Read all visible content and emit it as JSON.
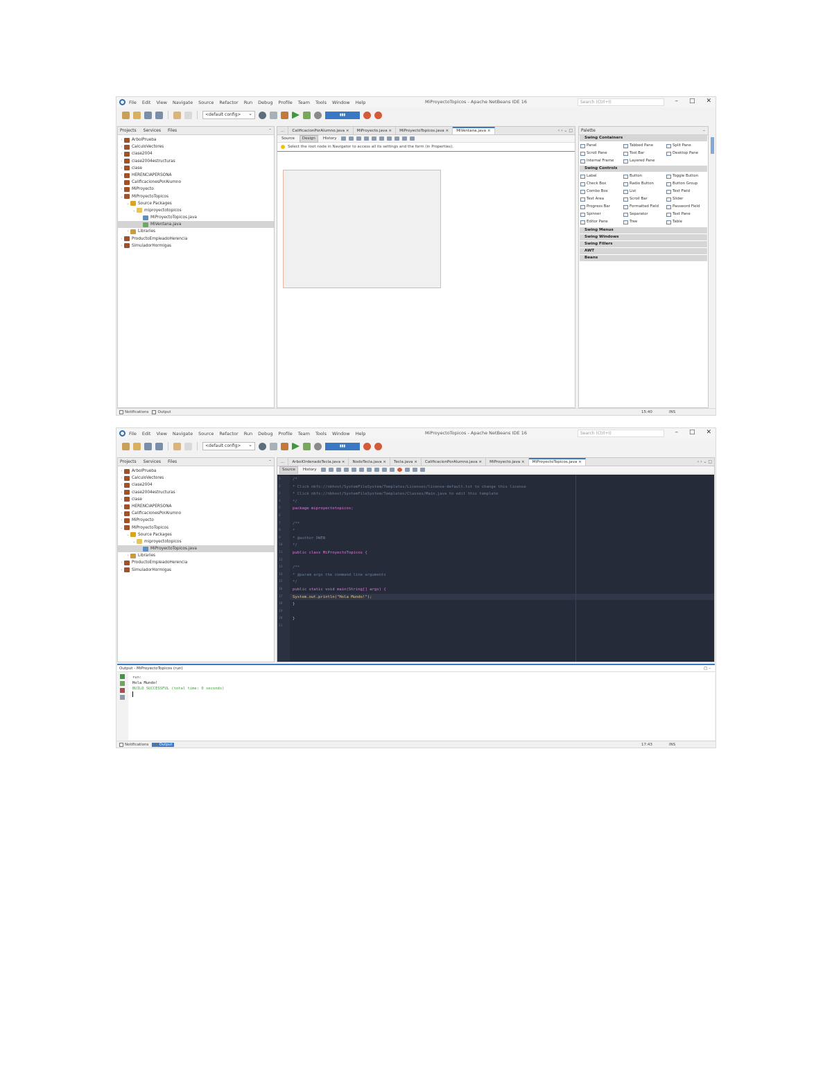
{
  "ide1": {
    "menu": [
      "File",
      "Edit",
      "View",
      "Navigate",
      "Source",
      "Refactor",
      "Run",
      "Debug",
      "Profile",
      "Team",
      "Tools",
      "Window",
      "Help"
    ],
    "window_title": "MiProyectoTopicos - Apache NetBeans IDE 16",
    "search_placeholder": "Search (Ctrl+I)",
    "config_select": "<default config>",
    "project_tabs": [
      "Projects",
      "Services",
      "Files"
    ],
    "tree": [
      {
        "label": "ArbolPrueba",
        "icon": "project-icon",
        "arrow": "›",
        "indent": 0
      },
      {
        "label": "CalculoVectores",
        "icon": "project-icon",
        "arrow": "›",
        "indent": 0
      },
      {
        "label": "clase2004",
        "icon": "project-icon",
        "arrow": "›",
        "indent": 0
      },
      {
        "label": "clase2004estructuras",
        "icon": "project-icon",
        "arrow": "›",
        "indent": 0
      },
      {
        "label": "clase",
        "icon": "project-icon",
        "arrow": "›",
        "indent": 0
      },
      {
        "label": "HERENCIAPERSONA",
        "icon": "project-icon",
        "arrow": "›",
        "indent": 0
      },
      {
        "label": "CalificacionesPorAlumno",
        "icon": "project-icon",
        "arrow": "",
        "indent": 0
      },
      {
        "label": "MiProyecto",
        "icon": "project-icon",
        "arrow": "›",
        "indent": 0
      },
      {
        "label": "MiProyectoTopicos",
        "icon": "project-icon",
        "arrow": "⌄",
        "indent": 0
      },
      {
        "label": "Source Packages",
        "icon": "package-folder-icon",
        "arrow": "⌄",
        "indent": 1
      },
      {
        "label": "miproyectotopicos",
        "icon": "package-icon",
        "arrow": "⌄",
        "indent": 2
      },
      {
        "label": "MiProyectoTopicos.java",
        "icon": "java-file-icon",
        "arrow": "",
        "indent": 3
      },
      {
        "label": "MiVentana.java",
        "icon": "form-file-icon",
        "arrow": "",
        "indent": 3,
        "selected": true
      },
      {
        "label": "Libraries",
        "icon": "library-icon",
        "arrow": "›",
        "indent": 1
      },
      {
        "label": "ProductoEmpleadoHerencia",
        "icon": "project-icon",
        "arrow": "›",
        "indent": 0
      },
      {
        "label": "SimuladorHormigas",
        "icon": "project-icon",
        "arrow": "›",
        "indent": 0
      }
    ],
    "editor_tabs": [
      "CalificacionPorAlumno.java",
      "MiProyecto.java",
      "MiProyectoTopicos.java",
      "MiVentana.java"
    ],
    "editor_tabs_lead": "...",
    "active_tab": "MiVentana.java",
    "view_buttons": [
      "Source",
      "Design",
      "History"
    ],
    "design_hint": "Select the root node in Navigator to access all its settings and the form (in Properties).",
    "palette_title": "Palette",
    "palette": {
      "swing_containers": {
        "title": "Swing Containers",
        "items": [
          "Panel",
          "Tabbed Pane",
          "Split Pane",
          "Scroll Pane",
          "Tool Bar",
          "Desktop Pane",
          "Internal Frame",
          "Layered Pane"
        ]
      },
      "swing_controls": {
        "title": "Swing Controls",
        "items": [
          "Label",
          "Button",
          "Toggle Button",
          "Check Box",
          "Radio Button",
          "Button Group",
          "Combo Box",
          "List",
          "Text Field",
          "Text Area",
          "Scroll Bar",
          "Slider",
          "Progress Bar",
          "Formatted Field",
          "Password Field",
          "Spinner",
          "Separator",
          "Text Pane",
          "Editor Pane",
          "Tree",
          "Table"
        ]
      },
      "collapsed": [
        "Swing Menus",
        "Swing Windows",
        "Swing Fillers",
        "AWT",
        "Beans"
      ]
    },
    "status": {
      "navigator": "Notifications",
      "output": "Output",
      "position": "15:40",
      "mode": "INS"
    }
  },
  "ide2": {
    "menu": [
      "File",
      "Edit",
      "View",
      "Navigate",
      "Source",
      "Refactor",
      "Run",
      "Debug",
      "Profile",
      "Team",
      "Tools",
      "Window",
      "Help"
    ],
    "window_title": "MiProyectoTopicos - Apache NetBeans IDE 16",
    "search_placeholder": "Search (Ctrl+I)",
    "config_select": "<default config>",
    "project_tabs": [
      "Projects",
      "Services",
      "Files"
    ],
    "tree": [
      {
        "label": "ArbolPrueba",
        "icon": "project-icon",
        "arrow": "›",
        "indent": 0
      },
      {
        "label": "CalculoVectores",
        "icon": "project-icon",
        "arrow": "›",
        "indent": 0
      },
      {
        "label": "clase2004",
        "icon": "project-icon",
        "arrow": "›",
        "indent": 0
      },
      {
        "label": "clase2004estructuras",
        "icon": "project-icon",
        "arrow": "›",
        "indent": 0
      },
      {
        "label": "clase",
        "icon": "project-icon",
        "arrow": "›",
        "indent": 0
      },
      {
        "label": "HERENCIAPERSONA",
        "icon": "project-icon",
        "arrow": "›",
        "indent": 0
      },
      {
        "label": "CalificacionesPorAlumno",
        "icon": "project-icon",
        "arrow": "›",
        "indent": 0
      },
      {
        "label": "MiProyecto",
        "icon": "project-icon",
        "arrow": "›",
        "indent": 0
      },
      {
        "label": "MiProyectoTopicos",
        "icon": "project-icon",
        "arrow": "⌄",
        "indent": 0
      },
      {
        "label": "Source Packages",
        "icon": "package-folder-icon",
        "arrow": "⌄",
        "indent": 1
      },
      {
        "label": "miproyectotopicos",
        "icon": "package-icon",
        "arrow": "⌄",
        "indent": 2
      },
      {
        "label": "MiProyectoTopicos.java",
        "icon": "java-file-icon",
        "arrow": "",
        "indent": 3,
        "selected": true
      },
      {
        "label": "Libraries",
        "icon": "library-icon",
        "arrow": "›",
        "indent": 1
      },
      {
        "label": "ProductoEmpleadoHerencia",
        "icon": "project-icon",
        "arrow": "›",
        "indent": 0
      },
      {
        "label": "SimuladorHormigas",
        "icon": "project-icon",
        "arrow": "›",
        "indent": 0
      }
    ],
    "editor_tabs": [
      "ArbolOrdenadoTecla.java",
      "NodoTecla.java",
      "Tecla.java",
      "CalificacionPorAlumno.java",
      "MiProyecto.java",
      "MiProyectoTopicos.java"
    ],
    "editor_tabs_lead": "...",
    "active_tab": "MiProyectoTopicos.java",
    "view_buttons": [
      "Source",
      "History"
    ],
    "code": [
      {
        "n": "1",
        "t": "/*",
        "cls": "c-com"
      },
      {
        "n": "2",
        "t": " * Click nbfs://nbhost/SystemFileSystem/Templates/Licenses/license-default.txt to change this license",
        "cls": "c-com"
      },
      {
        "n": "3",
        "t": " * Click nbfs://nbhost/SystemFileSystem/Templates/Classes/Main.java to edit this template",
        "cls": "c-com"
      },
      {
        "n": "4",
        "t": " */",
        "cls": "c-com"
      },
      {
        "n": "5",
        "t": "package miproyectotopicos;",
        "cls": "c-kw"
      },
      {
        "n": "6",
        "t": "",
        "cls": ""
      },
      {
        "n": "7",
        "t": "/**",
        "cls": "c-com"
      },
      {
        "n": "8",
        "t": " *",
        "cls": "c-com"
      },
      {
        "n": "9",
        "t": " * @author OWEN",
        "cls": "c-com"
      },
      {
        "n": "10",
        "t": " */",
        "cls": "c-com"
      },
      {
        "n": "11",
        "t": "public class MiProyectoTopicos {",
        "cls": "c-kw"
      },
      {
        "n": "12",
        "t": "",
        "cls": ""
      },
      {
        "n": "13",
        "t": "    /**",
        "cls": "c-com"
      },
      {
        "n": "14",
        "t": "     * @param args the command line arguments",
        "cls": "c-com"
      },
      {
        "n": "15",
        "t": "     */",
        "cls": "c-com"
      },
      {
        "n": "16",
        "t": "    public static void main(String[] args) {",
        "cls": "c-kw"
      },
      {
        "n": "17",
        "t": "        System.out.println(\"Hola Mundo!\");",
        "cls": "c-str"
      },
      {
        "n": "18",
        "t": "    }",
        "cls": ""
      },
      {
        "n": "19",
        "t": "",
        "cls": ""
      },
      {
        "n": "20",
        "t": "}",
        "cls": ""
      },
      {
        "n": "21",
        "t": "",
        "cls": ""
      }
    ],
    "output": {
      "title": "Output - MiProyectoTopicos (run)",
      "lines": [
        {
          "t": "run:",
          "cls": "run"
        },
        {
          "t": "Hola Mundo!",
          "cls": "res"
        },
        {
          "t": "BUILD SUCCESSFUL (total time: 0 seconds)",
          "cls": "ok"
        }
      ]
    },
    "status": {
      "navigator": "Notifications",
      "output": "Output",
      "position": "17:43",
      "mode": "INS"
    }
  }
}
